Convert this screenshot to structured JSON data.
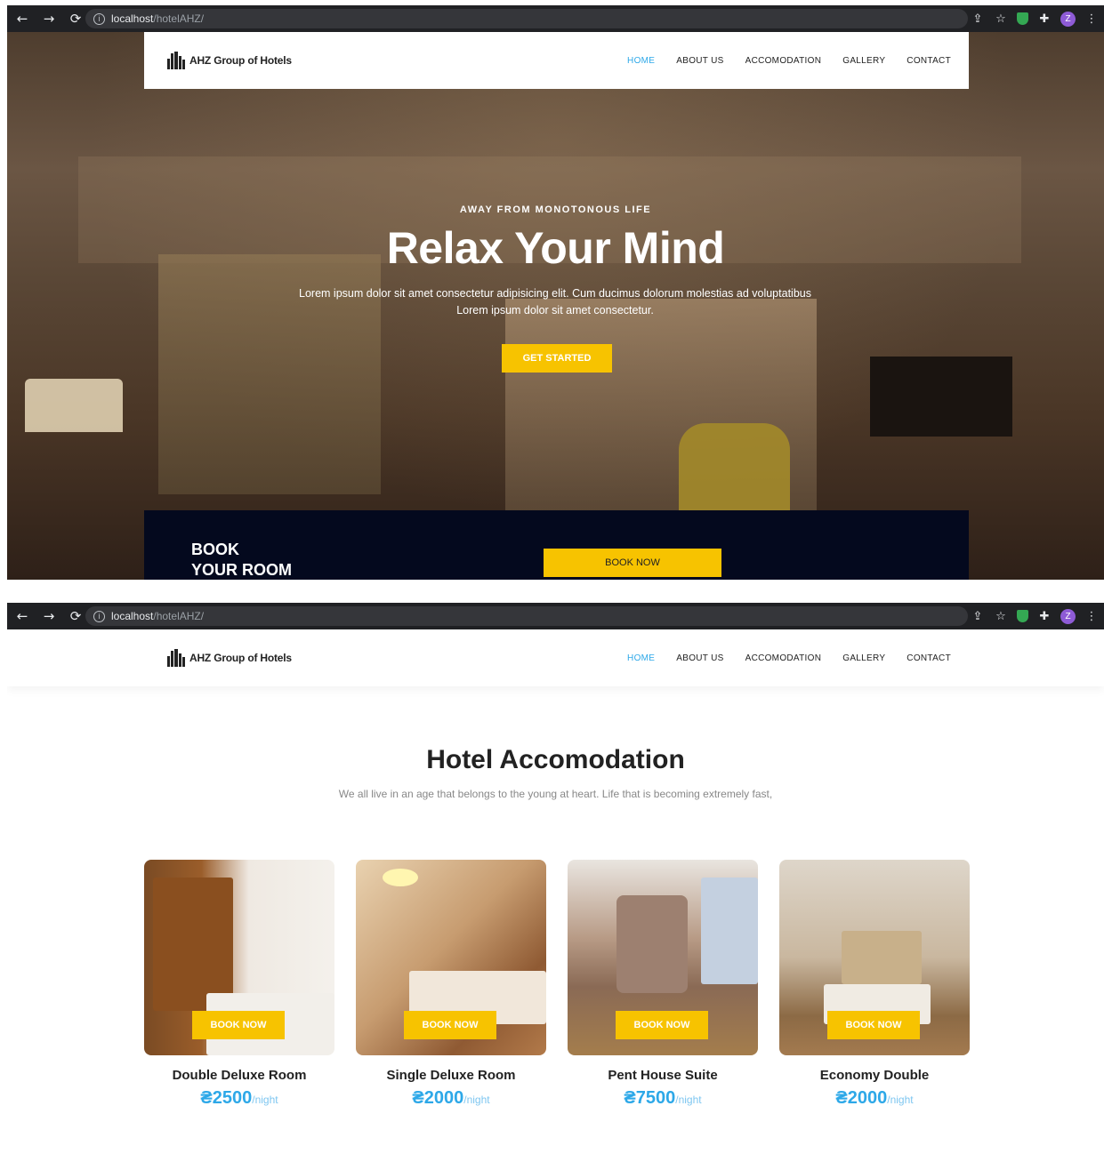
{
  "browser": {
    "url_host": "localhost",
    "url_path": "/hotelAHZ/",
    "profile_initial": "Z"
  },
  "site": {
    "logo_text": "AHZ Group of Hotels",
    "menu": [
      "HOME",
      "ABOUT US",
      "ACCOMODATION",
      "GALLERY",
      "CONTACT"
    ],
    "active_menu": "HOME"
  },
  "hero": {
    "eyebrow": "AWAY FROM MONOTONOUS LIFE",
    "title": "Relax Your Mind",
    "subtitle": "Lorem ipsum dolor sit amet consectetur adipisicing elit. Cum ducimus dolorum molestias ad voluptatibus Lorem ipsum dolor sit amet consectetur.",
    "cta": "GET STARTED",
    "book_title_1": "BOOK",
    "book_title_2": "YOUR ROOM",
    "book_button": "BOOK NOW"
  },
  "accommodation": {
    "title": "Hotel Accomodation",
    "subtitle": "We all live in an age that belongs to the young at heart. Life that is becoming extremely fast,",
    "rooms": [
      {
        "name": "Double Deluxe Room",
        "price": "₴2500",
        "unit": "/night",
        "button": "BOOK NOW"
      },
      {
        "name": "Single Deluxe Room",
        "price": "₴2000",
        "unit": "/night",
        "button": "BOOK NOW"
      },
      {
        "name": "Pent House Suite",
        "price": "₴7500",
        "unit": "/night",
        "button": "BOOK NOW"
      },
      {
        "name": "Economy Double",
        "price": "₴2000",
        "unit": "/night",
        "button": "BOOK NOW"
      }
    ]
  },
  "colors": {
    "accent": "#f7c300",
    "link_active": "#2da8e8",
    "booking_bar": "#04091e"
  }
}
